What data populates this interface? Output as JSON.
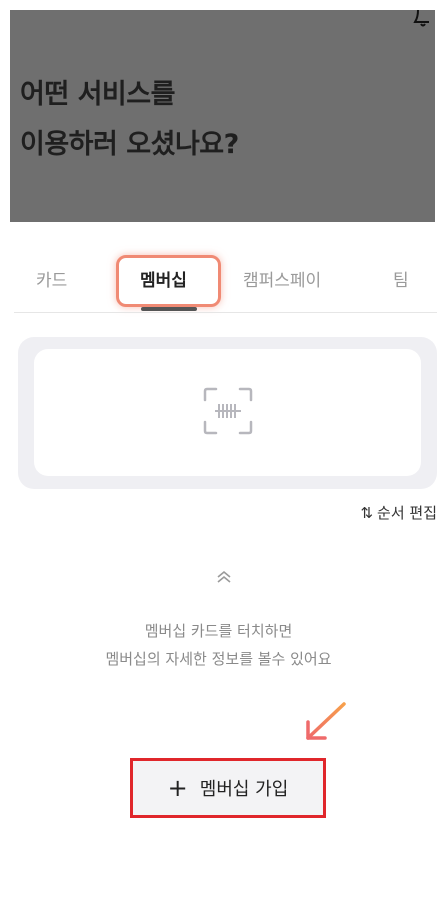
{
  "header": {
    "title_line1": "어떤 서비스를",
    "title_line2": "이용하러 오셨나요?"
  },
  "tabs": [
    {
      "label": "카드",
      "active": false
    },
    {
      "label": "멤버십",
      "active": true
    },
    {
      "label": "캠퍼스페이",
      "active": false
    },
    {
      "label": "팀",
      "active": false
    }
  ],
  "card": {
    "icon": "barcode-scan-icon"
  },
  "reorder": {
    "label": "순서 편집",
    "icon": "sort-arrows-icon"
  },
  "hint": {
    "line1": "멤버십 카드를 터치하면",
    "line2": "멤버십의 자세한 정보를 볼수 있어요"
  },
  "join_button": {
    "label": "멤버십 가입",
    "icon": "plus-icon"
  },
  "colors": {
    "header_bg": "#6f6f6f",
    "highlight_tab": "#f08a74",
    "highlight_button": "#e0262b",
    "arrow_gradient_start": "#f7a04b",
    "arrow_gradient_end": "#ef6a6a"
  }
}
